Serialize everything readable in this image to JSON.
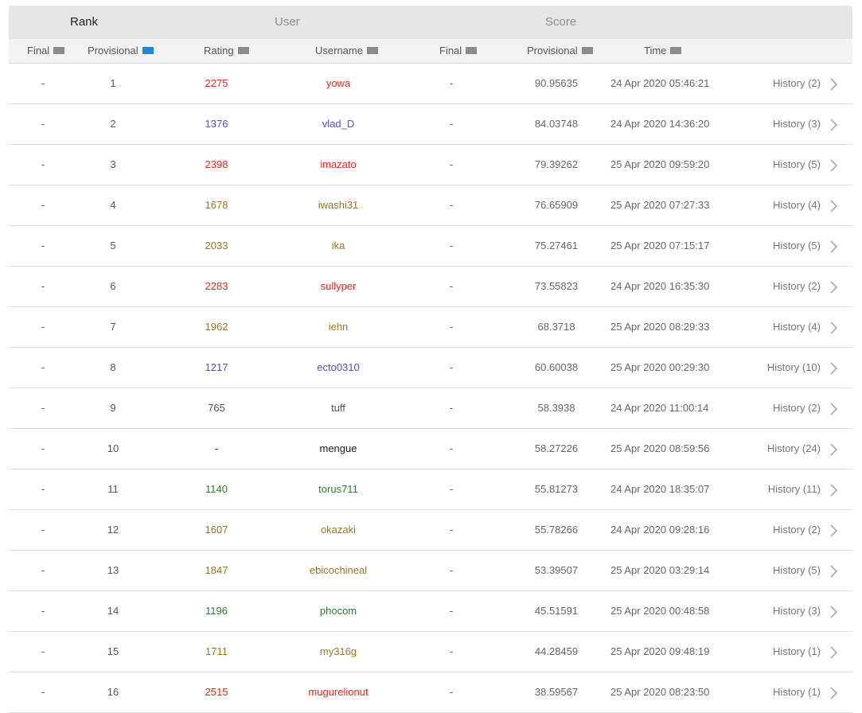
{
  "groups": {
    "rank": "Rank",
    "user": "User",
    "score": "Score"
  },
  "columns": {
    "final_rank": "Final",
    "provisional_rank": "Provisional",
    "rating": "Rating",
    "username": "Username",
    "final_score": "Final",
    "provisional_score": "Provisional",
    "time": "Time"
  },
  "colors": {
    "red": "#e0281f",
    "blue": "#4f4fd0",
    "yellow": "#9c7325",
    "gray": "#555555",
    "green": "#2e7d32",
    "sort_active": "#1e88e5"
  },
  "rows": [
    {
      "final": "-",
      "prov": "1",
      "rating": "2275",
      "user": "yowa",
      "color": "red",
      "sfinal": "-",
      "sprov": "90.95635",
      "time": "24 Apr 2020 05:46:21",
      "history": "History (2)"
    },
    {
      "final": "-",
      "prov": "2",
      "rating": "1376",
      "user": "vlad_D",
      "color": "blue",
      "sfinal": "-",
      "sprov": "84.03748",
      "time": "24 Apr 2020 14:36:20",
      "history": "History (3)"
    },
    {
      "final": "-",
      "prov": "3",
      "rating": "2398",
      "user": "imazato",
      "color": "red",
      "sfinal": "-",
      "sprov": "79.39262",
      "time": "25 Apr 2020 09:59:20",
      "history": "History (5)"
    },
    {
      "final": "-",
      "prov": "4",
      "rating": "1678",
      "user": "iwashi31",
      "color": "yellow",
      "sfinal": "-",
      "sprov": "76.65909",
      "time": "25 Apr 2020 07:27:33",
      "history": "History (4)"
    },
    {
      "final": "-",
      "prov": "5",
      "rating": "2033",
      "user": "ika",
      "color": "yellow",
      "sfinal": "-",
      "sprov": "75.27461",
      "time": "25 Apr 2020 07:15:17",
      "history": "History (5)"
    },
    {
      "final": "-",
      "prov": "6",
      "rating": "2283",
      "user": "sullyper",
      "color": "red",
      "sfinal": "-",
      "sprov": "73.55823",
      "time": "24 Apr 2020 16:35:30",
      "history": "History (2)"
    },
    {
      "final": "-",
      "prov": "7",
      "rating": "1962",
      "user": "iehn",
      "color": "yellow",
      "sfinal": "-",
      "sprov": "68.3718",
      "time": "25 Apr 2020 08:29:33",
      "history": "History (4)"
    },
    {
      "final": "-",
      "prov": "8",
      "rating": "1217",
      "user": "ecto0310",
      "color": "blue",
      "sfinal": "-",
      "sprov": "60.60038",
      "time": "25 Apr 2020 00:29:30",
      "history": "History (10)"
    },
    {
      "final": "-",
      "prov": "9",
      "rating": "765",
      "user": "tuff",
      "color": "gray",
      "sfinal": "-",
      "sprov": "58.3938",
      "time": "24 Apr 2020 11:00:14",
      "history": "History (2)"
    },
    {
      "final": "-",
      "prov": "10",
      "rating": "-",
      "user": "mengue",
      "color": "none",
      "sfinal": "-",
      "sprov": "58.27226",
      "time": "25 Apr 2020 08:59:56",
      "history": "History (24)"
    },
    {
      "final": "-",
      "prov": "11",
      "rating": "1140",
      "user": "torus711",
      "color": "green",
      "sfinal": "-",
      "sprov": "55.81273",
      "time": "24 Apr 2020 18:35:07",
      "history": "History (11)"
    },
    {
      "final": "-",
      "prov": "12",
      "rating": "1607",
      "user": "okazaki",
      "color": "yellow",
      "sfinal": "-",
      "sprov": "55.78266",
      "time": "24 Apr 2020 09:28:16",
      "history": "History (2)"
    },
    {
      "final": "-",
      "prov": "13",
      "rating": "1847",
      "user": "ebicochineal",
      "color": "yellow",
      "sfinal": "-",
      "sprov": "53.39507",
      "time": "25 Apr 2020 03:29:14",
      "history": "History (5)"
    },
    {
      "final": "-",
      "prov": "14",
      "rating": "1196",
      "user": "phocom",
      "color": "green",
      "sfinal": "-",
      "sprov": "45.51591",
      "time": "25 Apr 2020 00:48:58",
      "history": "History (3)"
    },
    {
      "final": "-",
      "prov": "15",
      "rating": "1711",
      "user": "my316g",
      "color": "yellow",
      "sfinal": "-",
      "sprov": "44.28459",
      "time": "25 Apr 2020 09:48:19",
      "history": "History (1)"
    },
    {
      "final": "-",
      "prov": "16",
      "rating": "2515",
      "user": "mugurelionut",
      "color": "red",
      "sfinal": "-",
      "sprov": "38.59567",
      "time": "25 Apr 2020 08:23:50",
      "history": "History (1)"
    }
  ]
}
